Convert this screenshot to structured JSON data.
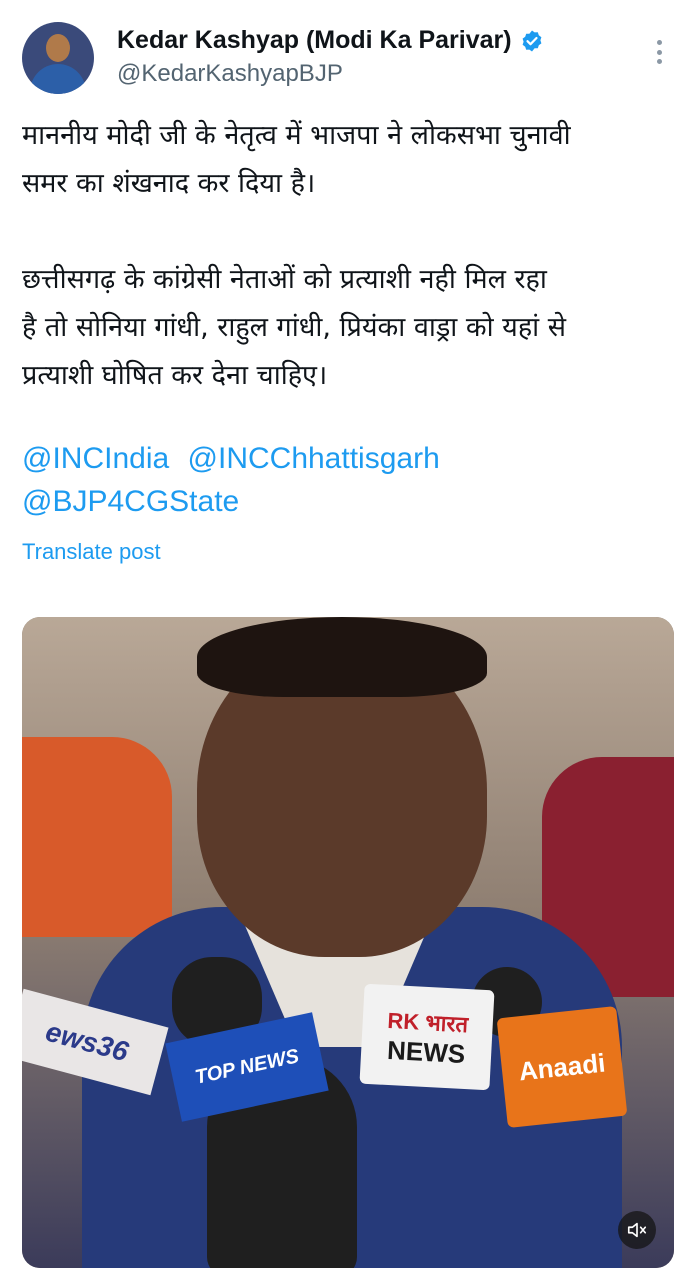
{
  "author": {
    "display_name": "Kedar Kashyap (Modi Ka Parivar)",
    "handle": "@KedarKashyapBJP",
    "verified": true,
    "verified_color": "#1d9bf0"
  },
  "tweet": {
    "paragraph1_line1": "माननीय मोदी जी के नेतृत्व में भाजपा ने लोकसभा चुनावी",
    "paragraph1_line2": "समर का शंखनाद कर दिया है।",
    "paragraph2_line1": "छत्तीसगढ़ के कांग्रेसी नेताओं को प्रत्याशी नही मिल रहा",
    "paragraph2_line2": "है तो सोनिया गांधी, राहुल गांधी, प्रियंका वाड्रा को यहां से",
    "paragraph2_line3": "प्रत्याशी घोषित कर देना चाहिए।",
    "mentions": [
      "@INCIndia",
      "@INCChhattisgarh",
      "@BJP4CGState"
    ],
    "translate_label": "Translate post"
  },
  "media": {
    "type": "video",
    "mic_labels": {
      "news36": "ews36",
      "top_news": "TOP NEWS",
      "rk_line1": "RK भारत",
      "rk_line2": "NEWS",
      "anaadi": "Anaadi"
    }
  },
  "icons": {
    "more": "more-vertical-icon",
    "verified": "verified-badge-icon",
    "mute": "volume-muted-icon"
  }
}
